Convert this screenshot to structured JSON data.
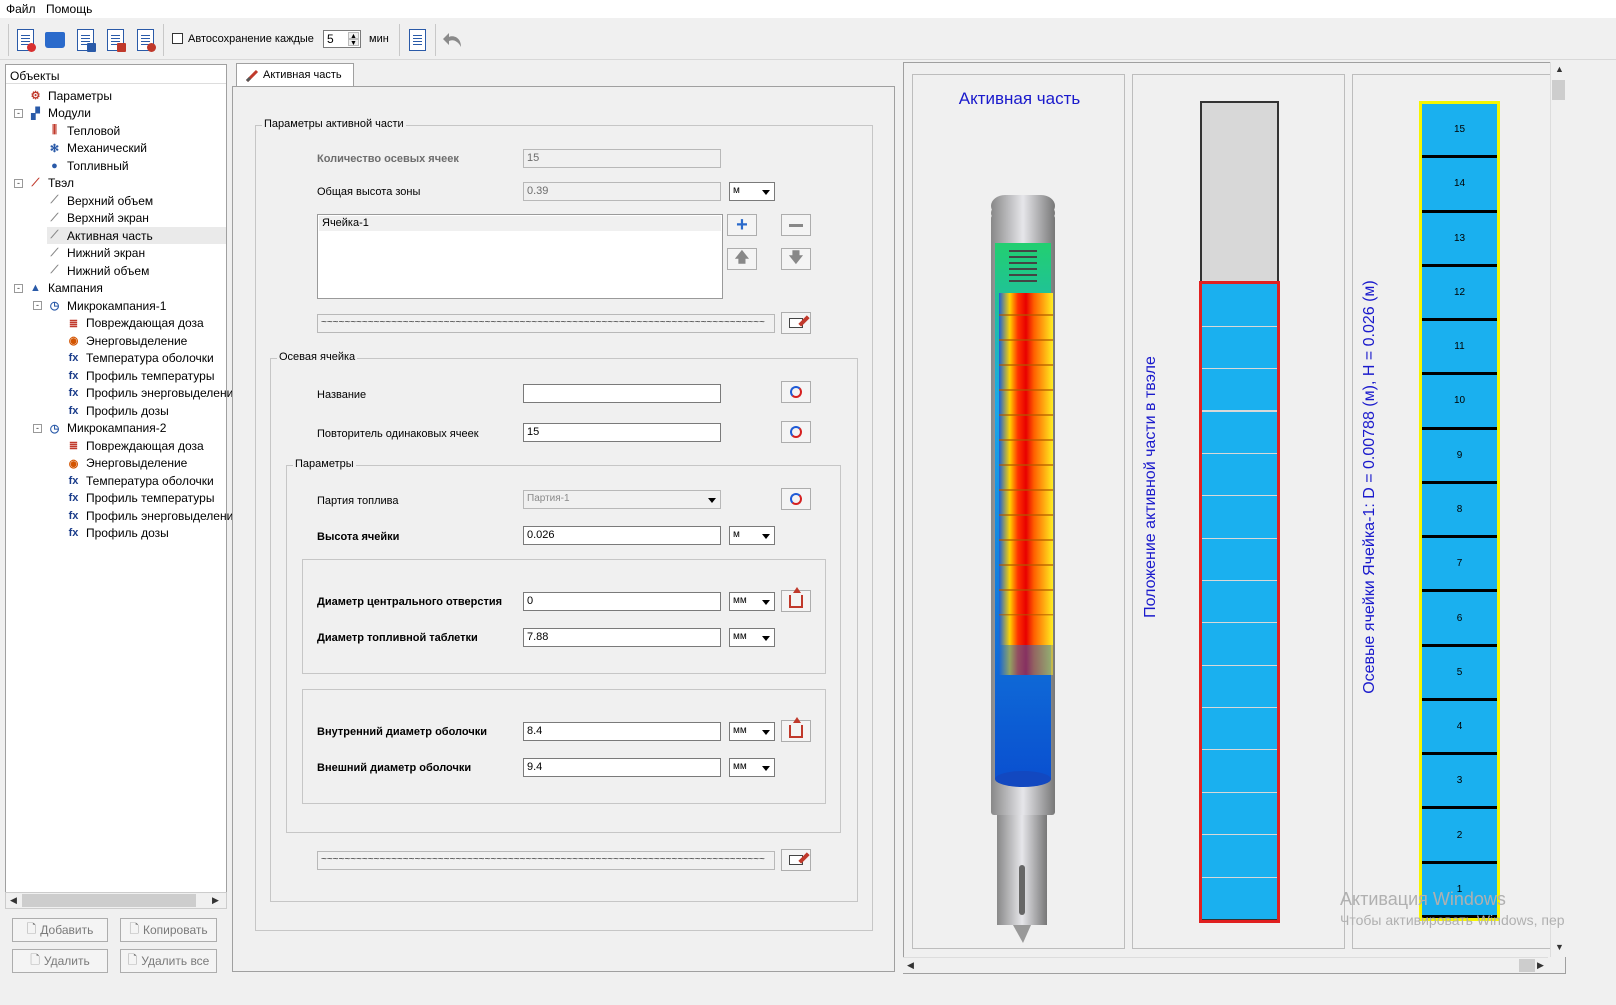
{
  "menu": {
    "file": "Файл",
    "help": "Помощь"
  },
  "toolbar": {
    "autosave_label": "Автосохранение каждые",
    "autosave_value": "5",
    "autosave_unit": "мин",
    "autosave_checked": false
  },
  "tree": {
    "header": "Объекты",
    "items": [
      {
        "label": "Параметры",
        "icon": "gear-icon"
      },
      {
        "label": "Модули",
        "icon": "modules-icon"
      },
      {
        "label": "Тепловой",
        "icon": "heat-icon"
      },
      {
        "label": "Механический",
        "icon": "mechanical-icon"
      },
      {
        "label": "Топливный",
        "icon": "fuel-icon"
      },
      {
        "label": "Твэл",
        "icon": "rod-icon"
      },
      {
        "label": "Верхний объем",
        "icon": "rod-part-icon"
      },
      {
        "label": "Верхний экран",
        "icon": "rod-part-icon"
      },
      {
        "label": "Активная часть",
        "icon": "rod-part-icon"
      },
      {
        "label": "Нижний экран",
        "icon": "rod-part-icon"
      },
      {
        "label": "Нижний объем",
        "icon": "rod-part-icon"
      },
      {
        "label": "Кампания",
        "icon": "campaign-icon"
      },
      {
        "label": "Микрокампания-1",
        "icon": "clock-icon"
      },
      {
        "label": "Повреждающая доза",
        "icon": "dose-icon"
      },
      {
        "label": "Энерговыделение",
        "icon": "energy-icon"
      },
      {
        "label": "Температура оболочки",
        "icon": "function-icon"
      },
      {
        "label": "Профиль температуры",
        "icon": "function-icon"
      },
      {
        "label": "Профиль энерговыделения",
        "icon": "function-icon"
      },
      {
        "label": "Профиль дозы",
        "icon": "function-icon"
      },
      {
        "label": "Микрокампания-2",
        "icon": "clock-icon"
      },
      {
        "label": "Повреждающая доза",
        "icon": "dose-icon"
      },
      {
        "label": "Энерговыделение",
        "icon": "energy-icon"
      },
      {
        "label": "Температура оболочки",
        "icon": "function-icon"
      },
      {
        "label": "Профиль температуры",
        "icon": "function-icon"
      },
      {
        "label": "Профиль энерговыделения",
        "icon": "function-icon"
      },
      {
        "label": "Профиль дозы",
        "icon": "function-icon"
      }
    ],
    "selected": "Активная часть"
  },
  "buttons": {
    "add": "Добавить",
    "copy": "Копировать",
    "delete": "Удалить",
    "delete_all": "Удалить все"
  },
  "tab": {
    "label": "Активная часть"
  },
  "form": {
    "group_active": "Параметры активной части",
    "axial_count_label": "Количество осевых ячеек",
    "axial_count_value": "15",
    "zone_height_label": "Общая высота зоны",
    "zone_height_value": "0.39",
    "zone_height_unit": "м",
    "cells": [
      "Ячейка-1"
    ],
    "path_value": "~~~~~~~~~~~~~~~~~~~~~~~~~~~~~~~~~~~~~~~~~~~~~~~~~~~~~~~~~~~~~~~~~~~~~~~~~~~~",
    "group_cell": "Осевая ячейка",
    "name_label": "Название",
    "name_value": "",
    "repeater_label": "Повторитель одинаковых ячеек",
    "repeater_value": "15",
    "group_params": "Параметры",
    "fuel_batch_label": "Партия топлива",
    "fuel_batch_value": "Партия-1",
    "cell_height_label": "Высота ячейки",
    "cell_height_value": "0.026",
    "cell_height_unit": "м",
    "center_hole_label": "Диаметр центрального отверстия",
    "center_hole_value": "0",
    "center_hole_unit": "мм",
    "pellet_diam_label": "Диаметр топливной таблетки",
    "pellet_diam_value": "7.88",
    "pellet_diam_unit": "мм",
    "clad_inner_label": "Внутренний диаметр оболочки",
    "clad_inner_value": "8.4",
    "clad_inner_unit": "мм",
    "clad_outer_label": "Внешний диаметр оболочки",
    "clad_outer_value": "9.4",
    "clad_outer_unit": "мм"
  },
  "viz": {
    "title": "Активная часть",
    "position_label": "Положение активной части в твэле",
    "cells_label": "Осевые ячейки Ячейка-1: D = 0.00788 (м), H = 0.026 (м)",
    "cell_count": 15,
    "active_fraction": 0.78
  },
  "watermark": {
    "line1": "Активация Windows",
    "line2": "Чтобы активировать Windows, пер"
  },
  "colors": {
    "cell_fill": "#1ab0ef",
    "active_border": "#e02020",
    "cells_border": "#f5f500",
    "title_color": "#1a1acc"
  }
}
